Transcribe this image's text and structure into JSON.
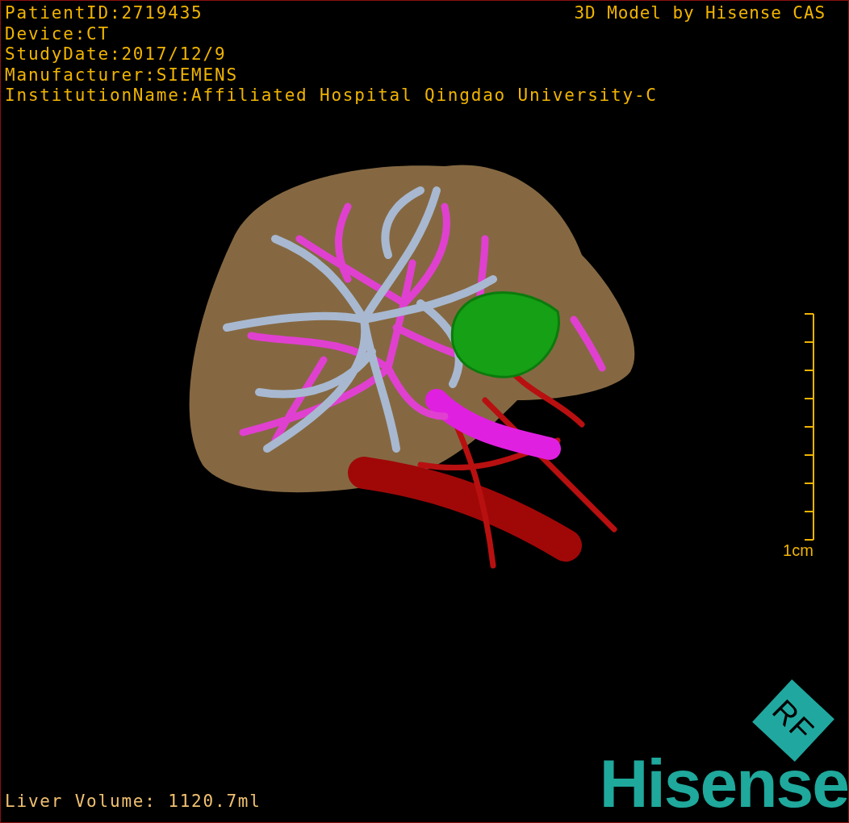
{
  "patient_info": [
    "PatientID:2719435",
    "Device:CT",
    "StudyDate:2017/12/9",
    "Manufacturer:SIEMENS",
    "InstitutionName:Affiliated Hospital Qingdao University-C"
  ],
  "model_title": "3D Model by Hisense CAS",
  "scale_bar": {
    "label": "1cm"
  },
  "liver_volume": "Liver Volume: 1120.7ml",
  "logo": {
    "badge": "RF",
    "wordmark": "Hisense"
  }
}
